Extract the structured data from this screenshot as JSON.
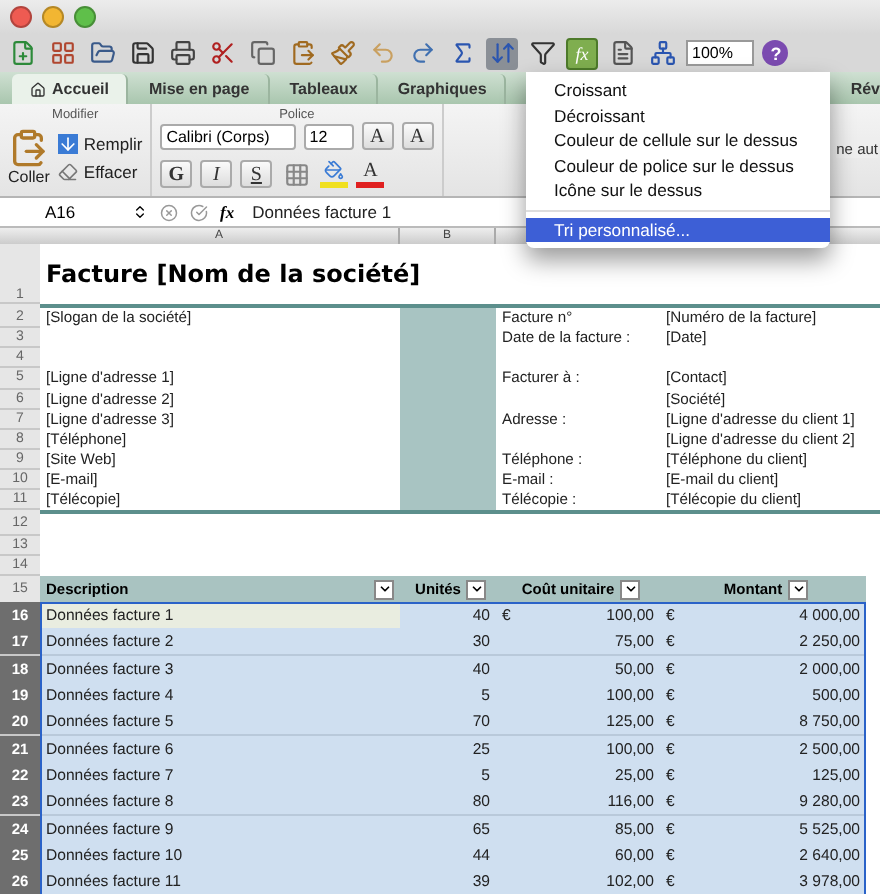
{
  "toolbar": {
    "zoom": "100%",
    "fx_button": "fx",
    "help": "?"
  },
  "tabs": [
    {
      "label": "Accueil",
      "selected": true
    },
    {
      "label": "Mise en page",
      "selected": false
    },
    {
      "label": "Tableaux",
      "selected": false
    },
    {
      "label": "Graphiques",
      "selected": false
    },
    {
      "label": "Rév",
      "selected": false
    }
  ],
  "ribbon": {
    "groups": [
      "Modifier",
      "Police"
    ],
    "paste": "Coller",
    "fill": "Remplir",
    "clear": "Effacer",
    "font": "Calibri (Corps)",
    "size": "12",
    "grow": "A",
    "shrink": "A",
    "bold": "G",
    "italic": "I",
    "underline": "S",
    "font_color": "A",
    "cut_text": "ne aut"
  },
  "formula_bar": {
    "cell": "A16",
    "fx": "fx",
    "value": "Données facture 1"
  },
  "column_headers": [
    "A",
    "B"
  ],
  "title_row": {
    "row": "1",
    "text": "Facture [Nom de la société]"
  },
  "info_rows": [
    {
      "row": "2",
      "left": "[Slogan de la société]",
      "label": "Facture n°",
      "value": "[Numéro de la facture]"
    },
    {
      "row": "3",
      "label": "Date de la facture :",
      "value": "[Date]"
    },
    {
      "row": "4"
    },
    {
      "row": "5",
      "left": "[Ligne d'adresse 1]",
      "label": "Facturer à :",
      "value": "[Contact]"
    },
    {
      "row": "6",
      "left": "[Ligne d'adresse 2]",
      "value": "[Société]"
    },
    {
      "row": "7",
      "left": "[Ligne d'adresse 3]",
      "label": "Adresse :",
      "value": "[Ligne d'adresse du client 1]"
    },
    {
      "row": "8",
      "left": "[Téléphone]",
      "value": "[Ligne d'adresse du client 2]"
    },
    {
      "row": "9",
      "left": "[Site Web]",
      "label": "Téléphone :",
      "value": "[Téléphone du client]"
    },
    {
      "row": "10",
      "left": "[E-mail]",
      "label": "E-mail :",
      "value": "[E-mail du client]"
    },
    {
      "row": "11",
      "left": "[Télécopie]",
      "label": "Télécopie :",
      "value": "[Télécopie du client]"
    }
  ],
  "blank_rows": [
    "12",
    "13",
    "14"
  ],
  "table": {
    "header_row": "15",
    "columns": [
      "Description",
      "Unités",
      "Coût unitaire",
      "Montant"
    ],
    "rows": [
      {
        "row": "16",
        "description": "Données facture 1",
        "units": "40",
        "cost_currency": "€",
        "cost": "100,00",
        "amount_currency": "€",
        "amount": "4 000,00",
        "selected": true,
        "active": true
      },
      {
        "row": "17",
        "description": "Données facture 2",
        "units": "30",
        "cost": "75,00",
        "amount_currency": "€",
        "amount": "2 250,00",
        "selected": true,
        "active": false
      },
      {
        "row": "18",
        "description": "Données facture 3",
        "units": "40",
        "cost": "50,00",
        "amount_currency": "€",
        "amount": "2 000,00",
        "selected": true,
        "active": false
      },
      {
        "row": "19",
        "description": "Données facture 4",
        "units": "5",
        "cost": "100,00",
        "amount_currency": "€",
        "amount": "500,00",
        "selected": true,
        "active": false
      },
      {
        "row": "20",
        "description": "Données facture 5",
        "units": "70",
        "cost": "125,00",
        "amount_currency": "€",
        "amount": "8 750,00",
        "selected": true,
        "active": false
      },
      {
        "row": "21",
        "description": "Données facture 6",
        "units": "25",
        "cost": "100,00",
        "amount_currency": "€",
        "amount": "2 500,00",
        "selected": true,
        "active": false
      },
      {
        "row": "22",
        "description": "Données facture 7",
        "units": "5",
        "cost": "25,00",
        "amount_currency": "€",
        "amount": "125,00",
        "selected": true,
        "active": false
      },
      {
        "row": "23",
        "description": "Données facture 8",
        "units": "80",
        "cost": "116,00",
        "amount_currency": "€",
        "amount": "9 280,00",
        "selected": true,
        "active": false
      },
      {
        "row": "24",
        "description": "Données facture 9",
        "units": "65",
        "cost": "85,00",
        "amount_currency": "€",
        "amount": "5 525,00",
        "selected": true,
        "active": false
      },
      {
        "row": "25",
        "description": "Données facture 10",
        "units": "44",
        "cost": "60,00",
        "amount_currency": "€",
        "amount": "2 640,00",
        "selected": true,
        "active": false
      },
      {
        "row": "26",
        "description": "Données facture 11",
        "units": "39",
        "cost": "102,00",
        "amount_currency": "€",
        "amount": "3 978,00",
        "selected": true,
        "active": false
      }
    ]
  },
  "sort_menu": {
    "items": [
      {
        "label": "Croissant",
        "selected": false
      },
      {
        "label": "Décroissant",
        "selected": false
      },
      {
        "label": "Couleur de cellule sur le dessus",
        "selected": false
      },
      {
        "label": "Couleur de police sur le dessus",
        "selected": false
      },
      {
        "label": "Icône sur le dessus",
        "selected": false
      },
      {
        "label": "Tri personnalisé...",
        "selected": true,
        "separated": true
      }
    ]
  }
}
